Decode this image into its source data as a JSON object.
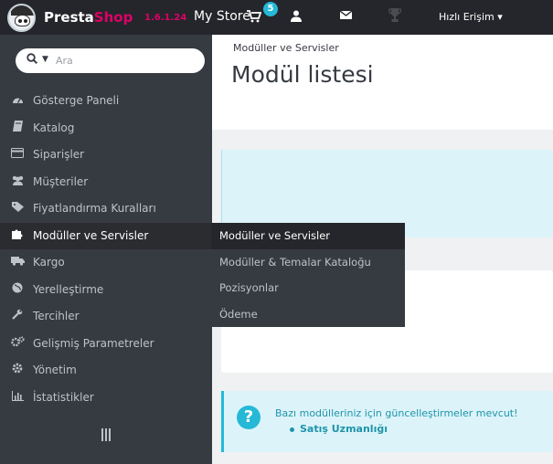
{
  "topbar": {
    "brand_presta": "Presta",
    "brand_shop": "Shop",
    "version": "1.6.1.24",
    "store_name": "My Store",
    "cart_count": "5",
    "quick_access": "Hızlı Erişim ▾",
    "icons": [
      "prestashop-logo",
      "cart-icon",
      "user-icon",
      "envelope-icon",
      "trophy-icon"
    ]
  },
  "sidebar": {
    "search_placeholder": "Ara",
    "items": [
      {
        "label": "Gösterge Paneli",
        "icon": "dashboard-icon"
      },
      {
        "label": "Katalog",
        "icon": "book-icon"
      },
      {
        "label": "Siparişler",
        "icon": "credit-card-icon"
      },
      {
        "label": "Müşteriler",
        "icon": "users-icon"
      },
      {
        "label": "Fiyatlandırma Kuralları",
        "icon": "tag-icon"
      },
      {
        "label": "Modüller ve Servisler",
        "icon": "puzzle-icon"
      },
      {
        "label": "Kargo",
        "icon": "truck-icon"
      },
      {
        "label": "Yerelleştirme",
        "icon": "globe-icon"
      },
      {
        "label": "Tercihler",
        "icon": "wrench-icon"
      },
      {
        "label": "Gelişmiş Parametreler",
        "icon": "cogs-icon"
      },
      {
        "label": "Yönetim",
        "icon": "cog-icon"
      },
      {
        "label": "İstatistikler",
        "icon": "bar-chart-icon"
      }
    ]
  },
  "submenu": {
    "items": [
      {
        "label": "Modüller ve Servisler"
      },
      {
        "label": "Modüller & Temalar Kataloğu"
      },
      {
        "label": "Pozisyonlar"
      },
      {
        "label": "Ödeme"
      }
    ]
  },
  "header": {
    "breadcrumb": "Modüller ve Servisler",
    "title": "Modül listesi"
  },
  "alert": {
    "message": "Bazı modülleriniz için güncelleştirmeler mevcut!",
    "items": [
      "Satış Uzmanlığı"
    ]
  },
  "colors": {
    "accent": "#25b9d7",
    "brand": "#df0067",
    "sidebar_bg": "#363a41",
    "topbar_bg": "#25262b"
  }
}
